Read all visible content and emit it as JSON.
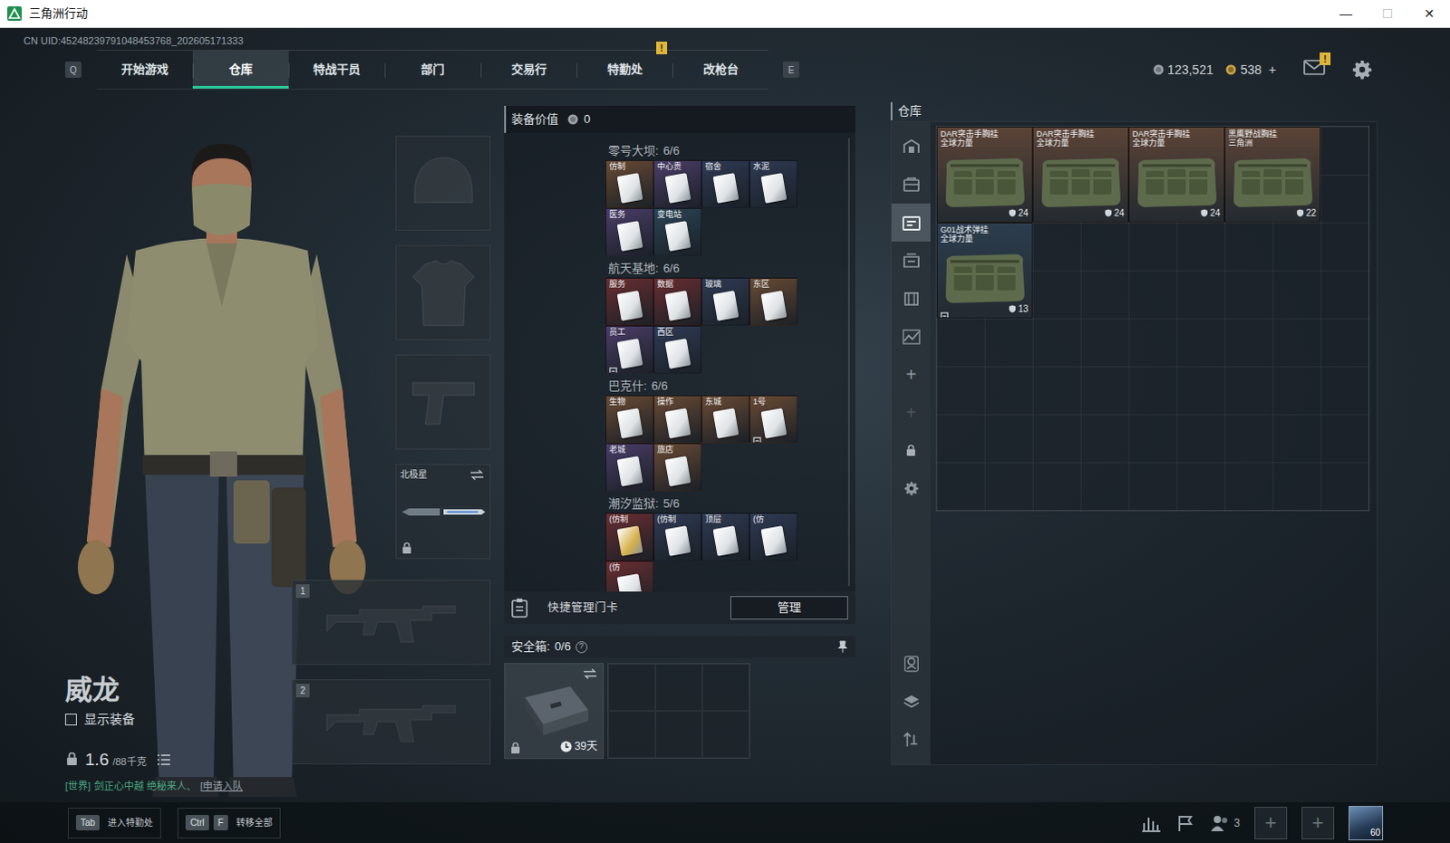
{
  "window": {
    "title": "三角洲行动",
    "controls": [
      {
        "glyph": "—",
        "disabled": false
      },
      {
        "glyph": "☐",
        "disabled": true
      },
      {
        "glyph": "✕",
        "disabled": false
      }
    ]
  },
  "uid": "CN UID:45248239791048453768_202605171333",
  "nav": {
    "prev_key": "Q",
    "next_key": "E",
    "alert_mark": "!",
    "tabs": [
      {
        "label": "开始游戏",
        "selected": false,
        "alert": false
      },
      {
        "label": "仓库",
        "selected": true,
        "alert": false
      },
      {
        "label": "特战干员",
        "selected": false,
        "alert": false
      },
      {
        "label": "部门",
        "selected": false,
        "alert": false
      },
      {
        "label": "交易行",
        "selected": false,
        "alert": false
      },
      {
        "label": "特勤处",
        "selected": false,
        "alert": true
      },
      {
        "label": "改枪台",
        "selected": false,
        "alert": false
      }
    ]
  },
  "wallet": {
    "coins": "123,521",
    "premium": "538",
    "add": "+"
  },
  "mail": {
    "alert": true,
    "badge": "!"
  },
  "operator": {
    "name": "威龙",
    "show_gear": {
      "label": "显示装备",
      "checked": false
    },
    "weight": "1.6",
    "weight_max": "/88千克",
    "locked": true
  },
  "chat": {
    "channel": "[世界]",
    "text": "剑正心中越  绝秘来人、",
    "link": "[申请入队"
  },
  "equipment": {
    "melee": {
      "name": "北极星",
      "locked": true
    },
    "weapons": [
      "1",
      "2"
    ]
  },
  "loadout_value": {
    "label": "装备价值",
    "value": "0"
  },
  "keycards": {
    "groups": [
      {
        "map": "零号大坝:",
        "count": "6/6",
        "cards": [
          {
            "label": "仿制",
            "color": "#6a4a34",
            "face": "#dfe3e6",
            "bound": false
          },
          {
            "label": "中心贵",
            "color": "#4b3d68",
            "face": "#dfe3e6",
            "bound": false
          },
          {
            "label": "宿舍",
            "color": "#2f3a54",
            "face": "#dfe3e6",
            "bound": false
          },
          {
            "label": "水泥",
            "color": "#2f3a54",
            "face": "#dfe3e6",
            "bound": false
          },
          {
            "label": "医务",
            "color": "#4b3d68",
            "face": "#dfe3e6",
            "bound": false
          },
          {
            "label": "变电站",
            "color": "#2b4456",
            "face": "#dfe3e6",
            "bound": false
          }
        ]
      },
      {
        "map": "航天基地:",
        "count": "6/6",
        "cards": [
          {
            "label": "服务",
            "color": "#6a2d31",
            "face": "#dfe3e6",
            "bound": false
          },
          {
            "label": "数据",
            "color": "#6a2d31",
            "face": "#dfe3e6",
            "bound": false
          },
          {
            "label": "玻璃",
            "color": "#2f3a54",
            "face": "#dfe3e6",
            "bound": false
          },
          {
            "label": "东区",
            "color": "#6a4a34",
            "face": "#dfe3e6",
            "bound": false
          },
          {
            "label": "员工",
            "color": "#4b3d68",
            "face": "#dfe3e6",
            "bound": true
          },
          {
            "label": "西区",
            "color": "#2f3a54",
            "face": "#dfe3e6",
            "bound": false
          }
        ]
      },
      {
        "map": "巴克什:",
        "count": "6/6",
        "cards": [
          {
            "label": "生物",
            "color": "#6a4a34",
            "face": "#dfe3e6",
            "bound": false
          },
          {
            "label": "操作",
            "color": "#6a4a34",
            "face": "#dfe3e6",
            "bound": false
          },
          {
            "label": "东城",
            "color": "#6a4a34",
            "face": "#dfe3e6",
            "bound": false
          },
          {
            "label": "1号",
            "color": "#6a4a34",
            "face": "#dfe3e6",
            "bound": true
          },
          {
            "label": "老城",
            "color": "#4b3d68",
            "face": "#dfe3e6",
            "bound": false
          },
          {
            "label": "旅店",
            "color": "#6a4a34",
            "face": "#dfe3e6",
            "bound": false
          }
        ]
      },
      {
        "map": "潮汐监狱:",
        "count": "5/6",
        "cards": [
          {
            "label": "(仿制",
            "color": "#6a2d31",
            "face": "#d6b04a",
            "bound": false
          },
          {
            "label": "(仿制",
            "color": "#2f3a54",
            "face": "#dfe3e6",
            "bound": false
          },
          {
            "label": "顶层",
            "color": "#2f3a54",
            "face": "#dfe3e6",
            "bound": false
          },
          {
            "label": "(仿",
            "color": "#2f3a54",
            "face": "#dfe3e6",
            "bound": false
          },
          {
            "label": "(仿",
            "color": "#6a2d31",
            "face": "#dfe3e6",
            "bound": false
          }
        ]
      }
    ]
  },
  "quick_manage": {
    "label": "快捷管理门卡",
    "button": "管理"
  },
  "safe": {
    "label": "安全箱:",
    "count": "0/6",
    "help": "?",
    "pinned": true,
    "locked": true,
    "timer": "39天"
  },
  "stash": {
    "title": "仓库",
    "tabs": [
      {
        "selected": false
      },
      {
        "selected": false
      },
      {
        "selected": true
      },
      {
        "selected": false
      },
      {
        "selected": false
      },
      {
        "selected": false
      }
    ],
    "actions": [
      {
        "glyph": "+",
        "disabled": false
      },
      {
        "glyph": "+",
        "disabled": true
      }
    ],
    "items": [
      {
        "name": "DAR突击手胸挂",
        "source": "全球力量",
        "durability": "24",
        "color": "#5b4336",
        "bound": false
      },
      {
        "name": "DAR突击手胸挂",
        "source": "全球力量",
        "durability": "24",
        "color": "#5b4336",
        "bound": false
      },
      {
        "name": "DAR突击手胸挂",
        "source": "全球力量",
        "durability": "24",
        "color": "#5b4336",
        "bound": false
      },
      {
        "name": "黑鹰野战胸挂",
        "source": "三角洲",
        "durability": "22",
        "color": "#5b4336",
        "bound": false
      },
      {
        "name": "G01战术弹挂",
        "source": "全球力量",
        "durability": "13",
        "color": "#2c3d4e",
        "bound": true
      }
    ]
  },
  "hints": [
    {
      "keys": [
        "Tab"
      ],
      "label": "进入特勤处"
    },
    {
      "keys": [
        "Ctrl",
        "F"
      ],
      "label": "转移全部"
    }
  ],
  "social": {
    "friends": "3",
    "add_slots": [
      "+",
      "+"
    ],
    "level": "60"
  }
}
